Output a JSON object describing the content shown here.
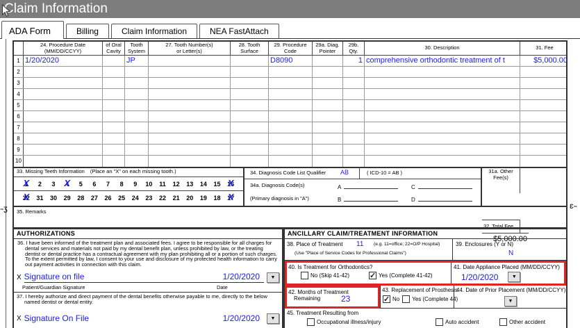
{
  "colors": {
    "accent_blue": "#1b1bf0",
    "highlight_red": "#e02424",
    "titlebar_gray": "#7d7d7d"
  },
  "titlebar": {
    "title": "Claim Information"
  },
  "tabs": [
    {
      "label": "ADA Form",
      "active": true
    },
    {
      "label": "Billing",
      "active": false
    },
    {
      "label": "Claim Information",
      "active": false
    },
    {
      "label": "NEA FastAttach",
      "active": false
    }
  ],
  "procedure_table": {
    "headers": [
      {
        "l1": "",
        "l2": ""
      },
      {
        "l1": "24. Procedure Date",
        "l2": "(MM/DD/CCYY)"
      },
      {
        "l1": "of Oral",
        "l2": "Cavity"
      },
      {
        "l1": "Tooth",
        "l2": "System"
      },
      {
        "l1": "27. Tooth Number(s)",
        "l2": "or Letter(s)"
      },
      {
        "l1": "28. Tooth",
        "l2": "Surface"
      },
      {
        "l1": "29. Procedure",
        "l2": "Code"
      },
      {
        "l1": "29a. Diag.",
        "l2": "Pointer"
      },
      {
        "l1": "29b.",
        "l2": "Qty."
      },
      {
        "l1": "30. Description",
        "l2": ""
      },
      {
        "l1": "31. Fee",
        "l2": ""
      }
    ],
    "rows": [
      {
        "num": "1",
        "date": "1/20/2020",
        "oral_cavity": "",
        "tooth_system": "JP",
        "tooth_numbers": "",
        "surface": "",
        "code": "D8090",
        "pointer": "",
        "qty": "1",
        "description": "comprehensive orthodontic treatment of t",
        "fee": "$5,000.00"
      },
      {
        "num": "2",
        "date": "",
        "oral_cavity": "",
        "tooth_system": "",
        "tooth_numbers": "",
        "surface": "",
        "code": "",
        "pointer": "",
        "qty": "",
        "description": "",
        "fee": ""
      },
      {
        "num": "3",
        "date": "",
        "oral_cavity": "",
        "tooth_system": "",
        "tooth_numbers": "",
        "surface": "",
        "code": "",
        "pointer": "",
        "qty": "",
        "description": "",
        "fee": ""
      },
      {
        "num": "4",
        "date": "",
        "oral_cavity": "",
        "tooth_system": "",
        "tooth_numbers": "",
        "surface": "",
        "code": "",
        "pointer": "",
        "qty": "",
        "description": "",
        "fee": ""
      },
      {
        "num": "5",
        "date": "",
        "oral_cavity": "",
        "tooth_system": "",
        "tooth_numbers": "",
        "surface": "",
        "code": "",
        "pointer": "",
        "qty": "",
        "description": "",
        "fee": ""
      },
      {
        "num": "6",
        "date": "",
        "oral_cavity": "",
        "tooth_system": "",
        "tooth_numbers": "",
        "surface": "",
        "code": "",
        "pointer": "",
        "qty": "",
        "description": "",
        "fee": ""
      },
      {
        "num": "7",
        "date": "",
        "oral_cavity": "",
        "tooth_system": "",
        "tooth_numbers": "",
        "surface": "",
        "code": "",
        "pointer": "",
        "qty": "",
        "description": "",
        "fee": ""
      },
      {
        "num": "8",
        "date": "",
        "oral_cavity": "",
        "tooth_system": "",
        "tooth_numbers": "",
        "surface": "",
        "code": "",
        "pointer": "",
        "qty": "",
        "description": "",
        "fee": ""
      },
      {
        "num": "9",
        "date": "",
        "oral_cavity": "",
        "tooth_system": "",
        "tooth_numbers": "",
        "surface": "",
        "code": "",
        "pointer": "",
        "qty": "",
        "description": "",
        "fee": ""
      },
      {
        "num": "10",
        "date": "",
        "oral_cavity": "",
        "tooth_system": "",
        "tooth_numbers": "",
        "surface": "",
        "code": "",
        "pointer": "",
        "qty": "",
        "description": "",
        "fee": ""
      }
    ]
  },
  "missing_teeth": {
    "label": "33. Missing Teeth Information",
    "note": "(Place an \"X\" on each missing tooth.)",
    "upper": [
      "1",
      "2",
      "3",
      "4",
      "5",
      "6",
      "7",
      "8",
      "9",
      "10",
      "11",
      "12",
      "13",
      "14",
      "15",
      "16"
    ],
    "lower": [
      "32",
      "31",
      "30",
      "29",
      "28",
      "27",
      "26",
      "25",
      "24",
      "23",
      "22",
      "21",
      "20",
      "19",
      "18",
      "17"
    ],
    "missing": [
      "1",
      "4",
      "16",
      "32",
      "17"
    ],
    "x_mark": "X"
  },
  "diagnosis": {
    "qualifier_label": "34. Diagnosis Code List Qualifier",
    "qualifier_value": "AB",
    "icd_note": "( ICD-10 = AB )",
    "codes_label": "34a. Diagnosis Code(s)",
    "primary_note": "(Primary diagnosis in \"A\")",
    "slot_a": "A",
    "slot_b": "B",
    "slot_c": "C",
    "slot_d": "D"
  },
  "fees": {
    "other_fee_label_1": "31a. Other",
    "other_fee_label_2": "Fee(s)",
    "total_fee_label": "32. Total Fee",
    "total_fee_value": "$5,000.00"
  },
  "remarks": {
    "label": "35. Remarks"
  },
  "authorizations": {
    "header": "AUTHORIZATIONS",
    "item36": "36. I have been informed of the treatment plan and associated fees. I agree to be responsible for all charges for dental services and materials not paid by my dental benefit plan, unless prohibited by law, or the treating dentist or dental practice has a contractual agreement with my plan prohibiting all or a portion of such charges. To the extent permitted by law, I consent to your use and disclosure of my protected health information to carry out payment activities in connection with this claim.",
    "x_mark": "X",
    "signature1": "Signature on file",
    "date1": "1/20/2020",
    "signature_label": "Patient/Guardian Signature",
    "date_label": "Date",
    "item37": "37. I hereby authorize and direct payment of the dental benefits otherwise payable to me, directly to the below named dentist or dental entity.",
    "signature2": "Signature On File",
    "date2": "1/20/2020"
  },
  "ancillary": {
    "header": "ANCILLARY CLAIM/TREATMENT INFORMATION",
    "place": {
      "label": "38. Place of Treatment",
      "value": "11",
      "hint": "(e.g. 11=office; 22=O/P Hospital)",
      "hint2": "(Use \"Place of Service Codes for Professional Claims\")"
    },
    "enclosures": {
      "label": "39. Enclosures (Y or N)",
      "value": "N"
    },
    "ortho": {
      "label": "40. Is Treatment for Orthodontics?",
      "no_label": "No  (Skip 41-42)",
      "yes_label": "Yes (Complete 41-42)",
      "no_checked": false,
      "yes_checked": true
    },
    "appliance_date": {
      "label": "41. Date Appliance Placed (MM/DD/CCYY)",
      "value": "1/20/2020"
    },
    "months": {
      "label_1": "42. Months of Treatment",
      "label_2": "Remaining",
      "value": "23"
    },
    "prosthesis": {
      "label": "43. Replacement of Prosthesis",
      "no_label": "No",
      "yes_label": "Yes (Complete 44)",
      "no_checked": true,
      "yes_checked": false
    },
    "prior_date": {
      "label": "44. Date of Prior Placement (MM/DD/CCYY)",
      "value": ""
    },
    "resulting": {
      "label": "45. Treatment Resulting from",
      "options": [
        {
          "label": "Occupational illness/injury",
          "checked": false
        },
        {
          "label": "Auto accident",
          "checked": false
        },
        {
          "label": "Other accident",
          "checked": false
        }
      ]
    }
  },
  "fold_marks": {
    "left": "Ʒ",
    "right": "Ɛ"
  },
  "dropdown_glyph": "▼"
}
